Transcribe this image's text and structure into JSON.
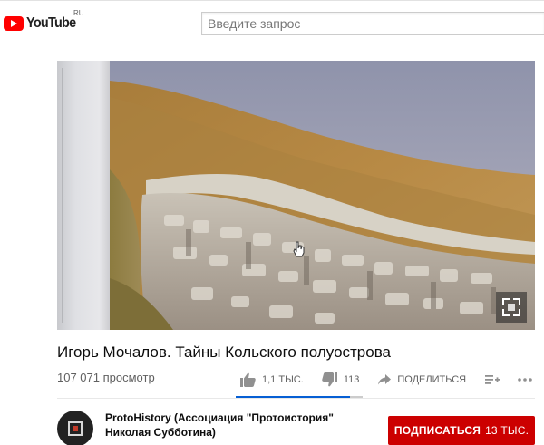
{
  "header": {
    "logo_text": "YouTube",
    "logo_region": "RU",
    "search_placeholder": "Введите запрос"
  },
  "video": {
    "title": "Игорь Мочалов. Тайны Кольского полуострова",
    "views": "107 071 просмотр",
    "likes": "1,1 ТЫС.",
    "dislikes": "113",
    "share_label": "ПОДЕЛИТЬСЯ",
    "like_ratio": 0.9
  },
  "channel": {
    "name": "ProtoHistory (Ассоциация \"Протоистория\" Николая Субботина)",
    "subscribe_label": "ПОДПИСАТЬСЯ",
    "subscriber_count": "13 ТЫС."
  },
  "colors": {
    "brand_red": "#ff0000",
    "subscribe_red": "#cc0000",
    "like_bar": "#065fd4"
  },
  "icons": {
    "like": "thumbs-up-icon",
    "dislike": "thumbs-down-icon",
    "share": "share-arrow-icon",
    "playlist": "add-to-playlist-icon",
    "more": "more-horizontal-icon",
    "fullscreen": "fullscreen-icon"
  }
}
